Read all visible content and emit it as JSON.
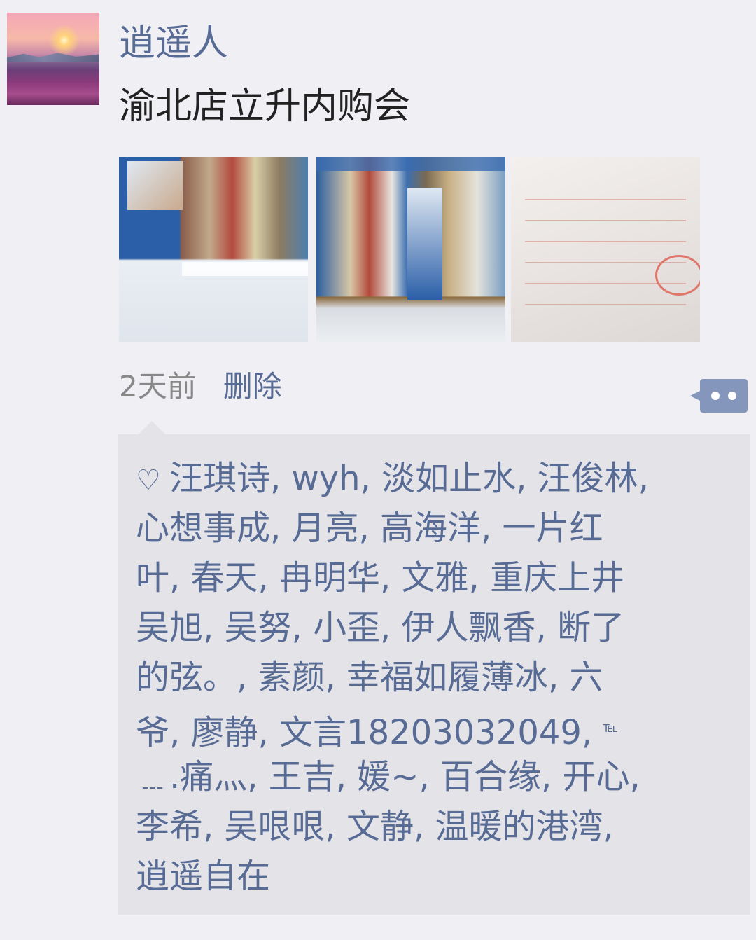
{
  "post": {
    "author": "逍遥人",
    "text": "渝北店立升内购会",
    "time": "2天前",
    "delete_label": "删除"
  },
  "likes": {
    "heart_icon": "heart-outline-icon",
    "lines": [
      "汪琪诗, wyh, 淡如止水, 汪俊林,",
      "心想事成, 月亮, 高海洋, 一片红",
      "叶, 春天, 冉明华, 文雅, 重庆上井",
      "吴旭, 吴努, 小歪, 伊人飘香, 断了",
      "的弦。, 素颜, 幸福如履薄冰, 六",
      "爷, 廖静, 文言18203032049,",
      "﹍.痛灬, 王吉, 媛~, 百合缘, 开心,",
      "李希, 吴哏哏, 文静, 温暖的港湾,",
      "逍遥自在"
    ],
    "tel_suffix": "℡"
  },
  "colors": {
    "link": "#576b95",
    "background": "#efeff4",
    "likes_bg": "#e3e3e8"
  }
}
